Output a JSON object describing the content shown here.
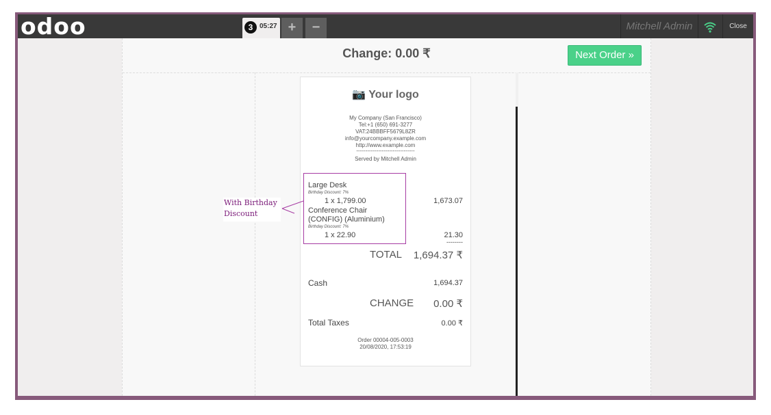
{
  "topbar": {
    "logo": "odoo",
    "order_number": "3",
    "order_time": "05:27",
    "add_label": "+",
    "remove_label": "−",
    "user": "Mitchell Admin",
    "close_label": "Close"
  },
  "screen": {
    "change_title": "Change: 0.00 ₹",
    "next_order_label": "Next Order »"
  },
  "receipt": {
    "logo": "📷 Your logo",
    "company": "My Company (San Francisco)",
    "tel": "Tel:+1 (650) 691-3277",
    "vat": "VAT:24BBBFF5679L8ZR",
    "email": "info@yourcompany.example.com",
    "website": "http://www.example.com",
    "separator": "--------------------------------",
    "served_by": "Served by Mitchell Admin",
    "lines": [
      {
        "name": "Large Desk",
        "discount": "Birthday Discount: 7%",
        "qty_price": "1 x 1,799.00",
        "total": "1,673.07"
      },
      {
        "name": "Conference Chair",
        "name2": "(CONFIG) (Aluminium)",
        "discount": "Birthday Discount: 7%",
        "qty_price": "1 x 22.90",
        "total": "21.30"
      }
    ],
    "dashes": "--------",
    "total_label": "TOTAL",
    "total_value": "1,694.37 ₹",
    "payment_label": "Cash",
    "payment_value": "1,694.37",
    "change_label": "CHANGE",
    "change_value": "0.00 ₹",
    "taxes_label": "Total Taxes",
    "taxes_value": "0.00 ₹",
    "order_ref": "Order 00004-005-0003",
    "order_date": "20/08/2020, 17:53:19"
  },
  "annotation": {
    "line1": "With Birthday",
    "line2": "Discount",
    "color": "#a63ba3"
  }
}
